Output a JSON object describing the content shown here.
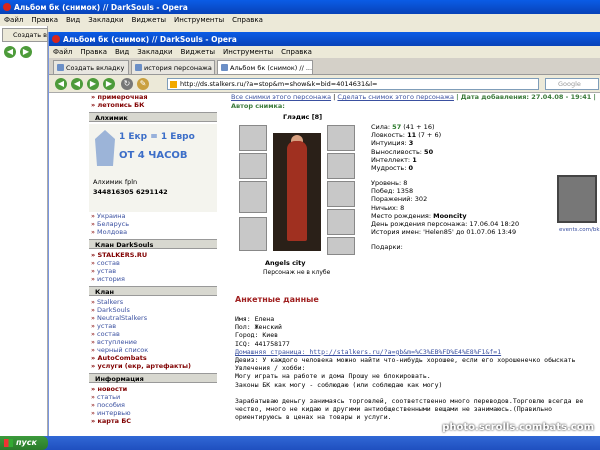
{
  "outer_window": {
    "title": "Альбом бк (снимок) // DarkSouls - Opera",
    "menu": [
      "Файл",
      "Правка",
      "Вид",
      "Закладки",
      "Виджеты",
      "Инструменты",
      "Справка"
    ],
    "tab": "Создать в"
  },
  "inner_window": {
    "title": "Альбом бк (снимок) // DarkSouls - Opera",
    "menu": [
      "Файл",
      "Правка",
      "Вид",
      "Закладки",
      "Виджеты",
      "Инструменты",
      "Справка"
    ],
    "tabs": [
      {
        "label": "Создать вкладку"
      },
      {
        "label": "история персонажа БК ..."
      },
      {
        "label": "Альбом бк (снимок) // ..."
      }
    ],
    "address": "http://ds.stalkers.ru/?a=stop&m=show&k=bid=4014631&l=",
    "search_placeholder": "Google"
  },
  "sidebar": {
    "top_links": [
      "примерочная",
      "летопись БК"
    ],
    "alchemist_title": "Алхимик",
    "alch_line1": "1 Екр = 1 Евро",
    "alch_line2": "ОТ 4 ЧАСОВ",
    "alch_who": "Алхимик",
    "alch_who2": "fpln",
    "alch_nums": "344816305 6291142",
    "lang_links": [
      "Украина",
      "Беларусь",
      "Молдова"
    ],
    "clan_ds_title": "Клан DarkSouls",
    "clan_ds_links": [
      "STALKERS.RU",
      "состав",
      "устав",
      "история"
    ],
    "clan_title": "Клан",
    "clan_links": [
      "Stalkers",
      "DarkSouls",
      "NeutralStalkers",
      "устав",
      "состав",
      "вступление",
      "черный список",
      "AutoCombats",
      "услуги (екр, артефакты)"
    ],
    "info_title": "Информация",
    "info_links": [
      "новости",
      "статьи",
      "пособия",
      "интервью",
      "карта БС"
    ]
  },
  "main": {
    "link_all": "Все снимки этого персонажа",
    "sep": "|",
    "link_make": "Сделать снимок этого персонажа",
    "date": "| Дата добавления: 27.04.08 - 19:41 |",
    "author": "Автор снимка:",
    "char_name": "Глэдис",
    "char_level": "[8]",
    "city": "Angels city",
    "club": "Персонаж не в клубе",
    "stats": [
      {
        "k": "Сила:",
        "v": "57",
        "x": "(41 + 16)"
      },
      {
        "k": "Ловкость:",
        "v": "11",
        "x": "(7 + 6)"
      },
      {
        "k": "Интуиция:",
        "v": "3",
        "x": ""
      },
      {
        "k": "Выносливость:",
        "v": "50",
        "x": ""
      },
      {
        "k": "Интеллект:",
        "v": "1",
        "x": ""
      },
      {
        "k": "Мудрость:",
        "v": "0",
        "x": ""
      }
    ],
    "stats2": [
      {
        "k": "Уровень:",
        "v": "8"
      },
      {
        "k": "Побед:",
        "v": "1358"
      },
      {
        "k": "Поражений:",
        "v": "302"
      },
      {
        "k": "Ничьих:",
        "v": "8"
      },
      {
        "k": "Место рождения:",
        "v": "Mooncity"
      },
      {
        "k": "День рождения персонажа:",
        "v": "17.06.04 18:20"
      },
      {
        "k": "История имен:",
        "v": "'Helen85' до 01.07.06 13:49"
      }
    ],
    "gifts": "Подарки:",
    "emblem_caption": "events.com/bk",
    "section_title": "Анкетные данные",
    "profile": [
      "Имя: Елена",
      "Пол: Женский",
      "Город: Киев",
      "ICQ: 441758177",
      "Домашняя страница: http://stalkers.ru/?a=gb&m=%C3%EB%FD%E4%E8%F1&f=1",
      "Девиз: У каждого человека можно найти что-нибудь хорошее, если его хорошенечко обыскать",
      "Увлечения / хобби:",
      "Могу играть на работе и дома  Прошу не блокировать.",
      "Законы БК как могу - соблюдаю (или соблюдаю как могу)",
      "",
      "Зарабатываю деньгу занимаясь торговлей, соответственно много переводов.Торговлю всегда ве",
      "чество, много не кидаю и другими антиобщественными вещами не занимаюсь.(Правильно",
      "ориентируюсь в ценах на товары и услуги."
    ]
  },
  "taskbar": {
    "start": "пуск"
  },
  "watermark": "photo.scrolls.combats.com"
}
